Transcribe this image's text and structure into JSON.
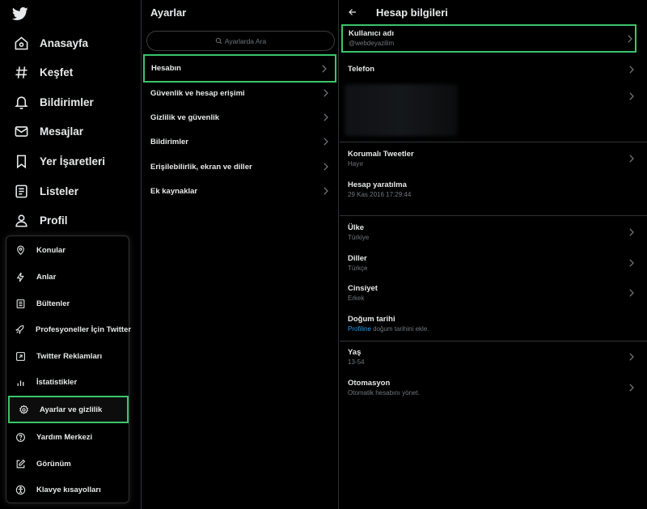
{
  "nav": {
    "logo": "twitter-bird",
    "items": [
      {
        "label": "Anasayfa",
        "icon": "home-icon"
      },
      {
        "label": "Keşfet",
        "icon": "hashtag-icon"
      },
      {
        "label": "Bildirimler",
        "icon": "bell-icon"
      },
      {
        "label": "Mesajlar",
        "icon": "envelope-icon"
      },
      {
        "label": "Yer İşaretleri",
        "icon": "bookmark-icon"
      },
      {
        "label": "Listeler",
        "icon": "list-icon"
      },
      {
        "label": "Profil",
        "icon": "person-icon"
      }
    ]
  },
  "more_menu": {
    "items": [
      {
        "label": "Konular",
        "icon": "topic-pin-icon"
      },
      {
        "label": "Anlar",
        "icon": "lightning-icon"
      },
      {
        "label": "Bültenler",
        "icon": "newsletter-icon"
      },
      {
        "label": "Profesyoneller İçin Twitter",
        "icon": "rocket-icon"
      },
      {
        "label": "Twitter Reklamları",
        "icon": "ads-arrow-icon"
      },
      {
        "label": "İstatistikler",
        "icon": "bar-chart-icon"
      },
      {
        "label": "Ayarlar ve gizlilik",
        "icon": "gear-icon",
        "highlighted": true
      },
      {
        "label": "Yardım Merkezi",
        "icon": "help-icon"
      },
      {
        "label": "Görünüm",
        "icon": "edit-icon"
      },
      {
        "label": "Klavye kısayolları",
        "icon": "accessibility-icon"
      }
    ]
  },
  "settings": {
    "title": "Ayarlar",
    "search_placeholder": "Ayarlarda Ara",
    "items": [
      {
        "label": "Hesabın",
        "highlighted": true
      },
      {
        "label": "Güvenlik ve hesap erişimi"
      },
      {
        "label": "Gizlilik ve güvenlik"
      },
      {
        "label": "Bildirimler"
      },
      {
        "label": "Erişilebilirlik, ekran ve diller"
      },
      {
        "label": "Ek kaynaklar"
      }
    ]
  },
  "detail": {
    "title": "Hesap bilgileri",
    "rows": {
      "username": {
        "title": "Kullanıcı adı",
        "sub": "@webdeyazilim"
      },
      "phone": {
        "title": "Telefon"
      },
      "protected": {
        "title": "Korumalı Tweetler",
        "sub": "Hayır"
      },
      "created": {
        "title": "Hesap yaratılma",
        "sub": "29 Kas 2016 17:29:44"
      },
      "country": {
        "title": "Ülke",
        "sub": "Türkiye"
      },
      "languages": {
        "title": "Diller",
        "sub": "Türkçe"
      },
      "gender": {
        "title": "Cinsiyet",
        "sub": "Erkek"
      },
      "birthday": {
        "title": "Doğum tarihi",
        "link": "Profiline",
        "sub_rest": " doğum tarihini ekle."
      },
      "age": {
        "title": "Yaş",
        "sub": "13-54"
      },
      "automation": {
        "title": "Otomasyon",
        "sub": "Otomatik hesabını yönet."
      }
    }
  },
  "colors": {
    "highlight": "#3bc46b",
    "link": "#1d9bf0",
    "muted": "#71767b",
    "divider": "#2f3336"
  }
}
